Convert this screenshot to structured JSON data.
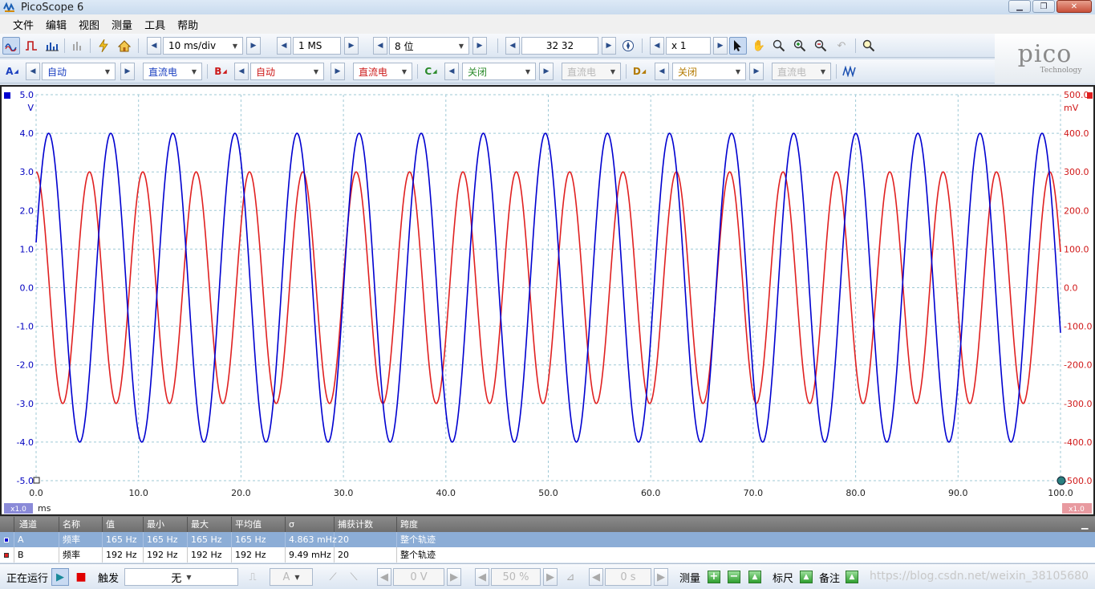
{
  "window": {
    "title": "PicoScope 6"
  },
  "menu": [
    "文件",
    "编辑",
    "视图",
    "测量",
    "工具",
    "帮助"
  ],
  "toolbar": {
    "timebase": "10 ms/div",
    "samples": "1 MS",
    "resolution": "8 位",
    "capture_count": "32 32",
    "zoom": "x 1"
  },
  "channels": {
    "A": {
      "label": "A",
      "range": "自动",
      "coupling": "直流电"
    },
    "B": {
      "label": "B",
      "range": "自动",
      "coupling": "直流电"
    },
    "C": {
      "label": "C",
      "range": "关闭",
      "coupling": "直流电"
    },
    "D": {
      "label": "D",
      "range": "关闭",
      "coupling": "直流电"
    }
  },
  "logo": {
    "name": "pico",
    "sub": "Technology"
  },
  "colors": {
    "channel_a": "#0000d0",
    "channel_b": "#e02020",
    "grid": "#9fc9d6"
  },
  "chart_data": {
    "type": "line",
    "title": "",
    "xlabel": "ms",
    "xlim": [
      0,
      100
    ],
    "x_ticks": [
      "0.0",
      "10.0",
      "20.0",
      "30.0",
      "40.0",
      "50.0",
      "60.0",
      "70.0",
      "80.0",
      "90.0",
      "100.0"
    ],
    "left_axis": {
      "unit": "V",
      "ylim": [
        -5,
        5
      ],
      "ticks": [
        "5.0",
        "4.0",
        "3.0",
        "2.0",
        "1.0",
        "0.0",
        "-1.0",
        "-2.0",
        "-3.0",
        "-4.0",
        "-5.0"
      ]
    },
    "right_axis": {
      "unit": "mV",
      "ylim": [
        -500,
        500
      ],
      "ticks": [
        "500.0",
        "400.0",
        "300.0",
        "200.0",
        "100.0",
        "0.0",
        "-100.0",
        "-200.0",
        "-300.0",
        "-400.0",
        "-500.0"
      ]
    },
    "scale_left": "x1.0",
    "scale_right": "x1.0",
    "grid": true,
    "series": [
      {
        "name": "A",
        "axis": "left",
        "amplitude": 4.0,
        "frequency_hz": 165,
        "phase_deg": 17,
        "x_start": 0,
        "x_end": 100
      },
      {
        "name": "B",
        "axis": "right",
        "amplitude": 300,
        "frequency_hz": 192,
        "phase_deg": 90,
        "x_start": 0,
        "x_end": 100
      }
    ]
  },
  "measurements": {
    "headers": [
      "通道",
      "名称",
      "值",
      "最小",
      "最大",
      "平均值",
      "σ",
      "捕获计数",
      "跨度"
    ],
    "rows": [
      {
        "channel": "A",
        "name": "频率",
        "value": "165 Hz",
        "min": "165 Hz",
        "max": "165 Hz",
        "avg": "165 Hz",
        "sigma": "4.863 mHz",
        "count": "20",
        "span": "整个轨迹"
      },
      {
        "channel": "B",
        "name": "频率",
        "value": "192 Hz",
        "min": "192 Hz",
        "max": "192 Hz",
        "avg": "192 Hz",
        "sigma": "9.49 mHz",
        "count": "20",
        "span": "整个轨迹"
      }
    ]
  },
  "status": {
    "running_label": "正在运行",
    "trigger_label": "触发",
    "trigger_mode": "无",
    "trigger_channel": "A",
    "trigger_level": "0 V",
    "pretrigger": "50 %",
    "delay": "0 s",
    "measure_label": "测量",
    "ruler_label": "标尺",
    "notes_label": "备注",
    "watermark": "https://blog.csdn.net/weixin_38105680"
  }
}
